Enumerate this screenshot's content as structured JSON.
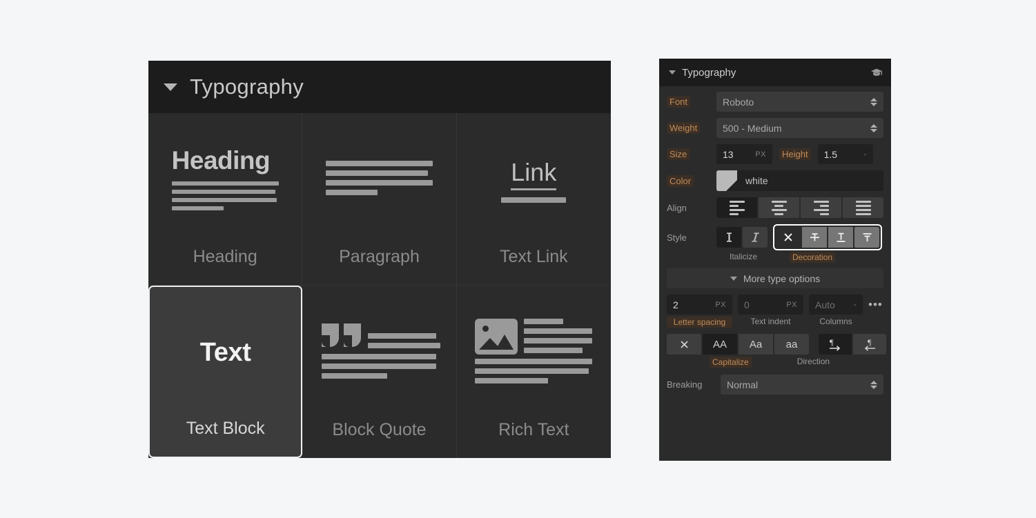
{
  "left_panel": {
    "header": {
      "title": "Typography",
      "caret_icon": "caret-down-icon"
    },
    "cards": [
      {
        "label": "Heading",
        "icon": "heading-icon",
        "glyph_text": "Heading",
        "selected": false
      },
      {
        "label": "Paragraph",
        "icon": "paragraph-icon",
        "selected": false
      },
      {
        "label": "Text Link",
        "icon": "text-link-icon",
        "glyph_text": "Link",
        "selected": false
      },
      {
        "label": "Text Block",
        "icon": "text-block-icon",
        "glyph_text": "Text",
        "selected": true
      },
      {
        "label": "Block Quote",
        "icon": "block-quote-icon",
        "selected": false
      },
      {
        "label": "Rich Text",
        "icon": "rich-text-icon",
        "selected": false
      }
    ]
  },
  "right_panel": {
    "header": {
      "title": "Typography",
      "caret_icon": "caret-down-icon",
      "academy_icon": "graduation-cap-icon"
    },
    "font": {
      "label": "Font",
      "value": "Roboto",
      "label_highlighted": true
    },
    "weight": {
      "label": "Weight",
      "value": "500 - Medium",
      "label_highlighted": true
    },
    "size": {
      "label": "Size",
      "value": "13",
      "unit": "PX",
      "height_label": "Height",
      "height_value": "1.5",
      "height_unit": "-"
    },
    "color": {
      "label": "Color",
      "value": "white",
      "swatch_hex": "#b9b9b9"
    },
    "align": {
      "label": "Align",
      "options": [
        "align-left",
        "align-center",
        "align-right",
        "align-justify"
      ],
      "selected_index": 0
    },
    "style": {
      "label": "Style",
      "italicize_label": "Italicize",
      "italicize_options": [
        "upright",
        "italic"
      ],
      "italicize_selected_index": 0,
      "decoration_label": "Decoration",
      "decoration_label_highlighted": true,
      "decoration_options": [
        "none",
        "strikethrough",
        "underline",
        "overline"
      ],
      "decoration_selected_index": 0,
      "decoration_group_focused": true
    },
    "more_options": {
      "label": "More type options",
      "caret_icon": "caret-down-icon"
    },
    "spacing": {
      "letter_spacing": {
        "label": "Letter spacing",
        "value": "2",
        "unit": "PX",
        "label_highlighted": true
      },
      "text_indent": {
        "label": "Text indent",
        "value": "0",
        "unit": "PX"
      },
      "columns": {
        "label": "Columns",
        "value": "Auto",
        "unit": "-",
        "overflow_icon": "ellipsis-icon"
      }
    },
    "capitalize": {
      "label": "Capitalize",
      "label_highlighted": true,
      "options": [
        "none",
        "AA",
        "Aa",
        "aa"
      ],
      "selected_index": 1
    },
    "direction": {
      "label": "Direction",
      "options": [
        "ltr",
        "rtl"
      ],
      "selected_index": 0
    },
    "breaking": {
      "label": "Breaking",
      "value": "Normal"
    }
  },
  "colors": {
    "panel_bg": "#2b2b2b",
    "header_bg": "#1c1c1c",
    "page_bg": "#f4f6f8",
    "highlight_text": "#c08d5a",
    "highlight_bg": "#3c2f25",
    "selection_border": "#ffffff"
  }
}
